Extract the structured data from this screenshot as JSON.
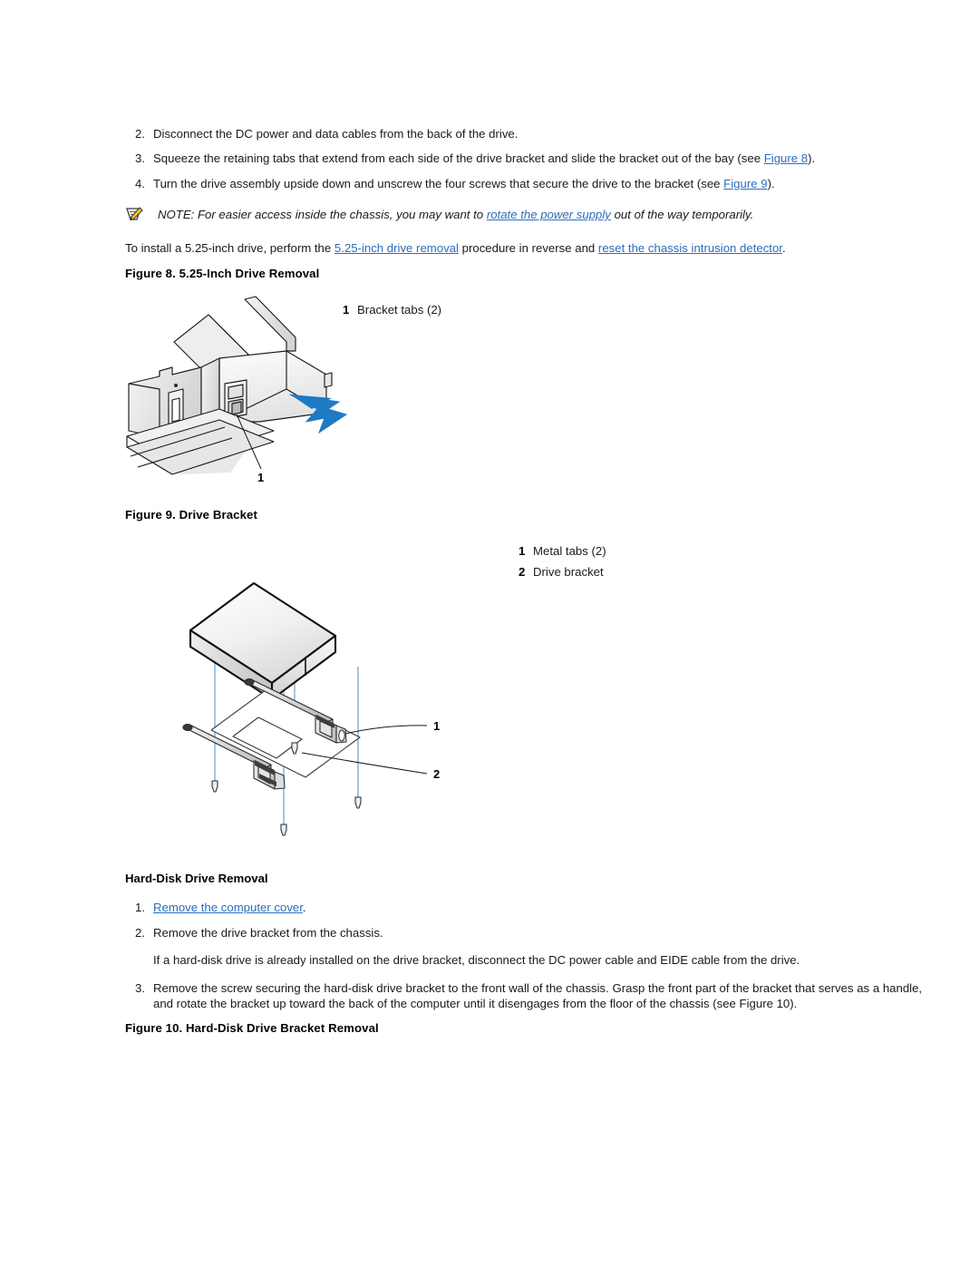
{
  "document": {
    "title": "5.25-Inch Drive Removal / Hard-Disk Drive Removal",
    "link_color": "#2a6ebb",
    "arrow_color": "#1f7ac4"
  },
  "steps_top": [
    {
      "num": "2.",
      "parts": [
        {
          "type": "text",
          "text": "Disconnect the DC power and data cables from the back of the drive."
        }
      ]
    },
    {
      "num": "3.",
      "parts": [
        {
          "type": "text",
          "text": "Squeeze the retaining tabs that extend from each side of the drive bracket and slide the bracket out of the bay (see "
        },
        {
          "type": "link",
          "text": "Figure 8"
        },
        {
          "type": "text",
          "text": ")."
        }
      ]
    },
    {
      "num": "4.",
      "parts": [
        {
          "type": "text",
          "text": "Turn the drive assembly upside down and unscrew the four screws that secure the drive to the bracket (see "
        },
        {
          "type": "link",
          "text": "Figure 9"
        },
        {
          "type": "text",
          "text": ")."
        }
      ]
    }
  ],
  "note": {
    "icon": "note-pencil-icon",
    "prefix": "NOTE: For easier access inside the chassis, you may want to ",
    "link": "rotate the power supply",
    "suffix": " out of the way temporarily."
  },
  "install_para": {
    "prefix": "To install a 5.25-inch drive, perform the ",
    "link1": "5.25-inch drive removal",
    "middle": " procedure in reverse and ",
    "link2": "reset the chassis intrusion detector",
    "suffix": "."
  },
  "figure8": {
    "caption": "Figure 8. 5.25-Inch Drive Removal",
    "legend": [
      {
        "num": "1",
        "label": "Bracket tabs (2)"
      }
    ],
    "callouts": [
      "1"
    ]
  },
  "figure9": {
    "caption": "Figure 9. Drive Bracket",
    "legend": [
      {
        "num": "1",
        "label": "Metal tabs (2)"
      },
      {
        "num": "2",
        "label": "Drive bracket"
      }
    ],
    "callouts": [
      "1",
      "2"
    ]
  },
  "hdd_section": {
    "heading": "Hard-Disk Drive Removal",
    "steps": [
      {
        "num": "1.",
        "parts": [
          {
            "type": "link",
            "text": "Remove the computer cover"
          },
          {
            "type": "text",
            "text": "."
          }
        ]
      },
      {
        "num": "2.",
        "parts": [
          {
            "type": "text",
            "text": "Remove the drive bracket from the chassis."
          }
        ]
      },
      {
        "num": "3.",
        "parts": [
          {
            "type": "text",
            "text": "Remove the screw securing the hard-disk drive bracket to the front wall of the chassis. Grasp the front part of the bracket that serves as a handle, and rotate the bracket up toward the back of the computer until it disengages from the floor of the chassis (see Figure 10)."
          }
        ]
      }
    ],
    "substep_text": "If a hard-disk drive is already installed on the drive bracket, disconnect the DC power cable and EIDE cable from the drive."
  },
  "figure10": {
    "caption": "Figure 10. Hard-Disk Drive Bracket Removal"
  }
}
